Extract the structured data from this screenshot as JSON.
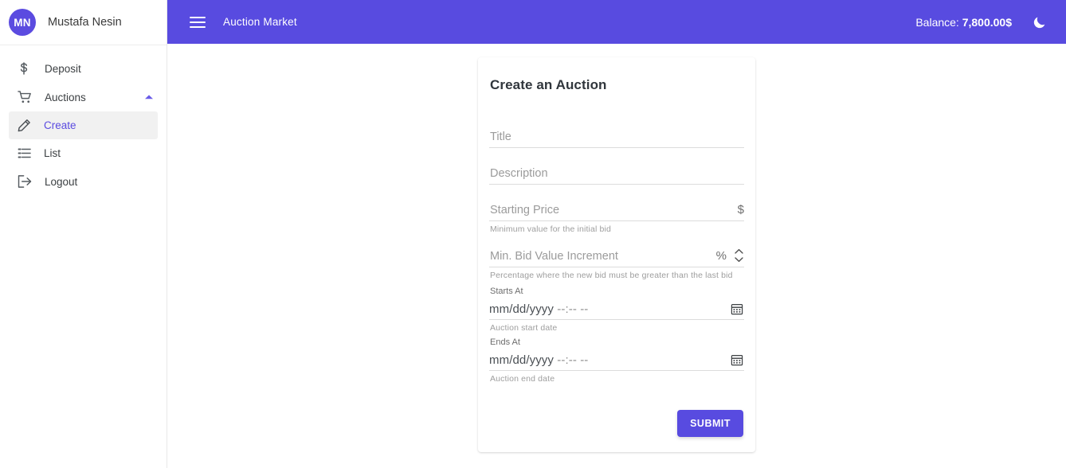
{
  "colors": {
    "accent": "#584be0",
    "accent_light": "#5b4be0",
    "sidebar_active_bg": "#f1f1f1",
    "page_bg": "#ffffff",
    "helper_text": "#9e9e9e"
  },
  "sidebar": {
    "profile": {
      "initials": "MN",
      "name": "Mustafa Nesin",
      "avatar_icon": "avatar-initials"
    },
    "items": [
      {
        "label": "Deposit",
        "icon": "dollar-icon",
        "level": "top",
        "active": false,
        "expandable": false
      },
      {
        "label": "Auctions",
        "icon": "shopping-cart-icon",
        "level": "top",
        "active": false,
        "expandable": true,
        "expand_icon": "chevron-up-icon"
      },
      {
        "label": "Create",
        "icon": "pencil-icon",
        "level": "sub",
        "active": true,
        "expandable": false
      },
      {
        "label": "List",
        "icon": "list-icon",
        "level": "sub",
        "active": false,
        "expandable": false
      },
      {
        "label": "Logout",
        "icon": "logout-icon",
        "level": "top",
        "active": false,
        "expandable": false
      }
    ]
  },
  "topbar": {
    "menu_icon": "hamburger-menu-icon",
    "title": "Auction Market",
    "balance_label": "Balance:",
    "balance_value": "7,800.00$",
    "theme_toggle_icon": "moon-icon"
  },
  "card": {
    "title": "Create an Auction",
    "fields": {
      "title": {
        "placeholder": "Title",
        "value": ""
      },
      "description": {
        "placeholder": "Description",
        "value": ""
      },
      "starting_price": {
        "placeholder": "Starting Price",
        "value": "",
        "adornment": "$",
        "helper": "Minimum value for the initial bid"
      },
      "min_bid_increment": {
        "placeholder": "Min. Bid Value Increment",
        "value": "",
        "adornment": "%",
        "spinner_icon": "number-spinner-icon",
        "helper": "Percentage where the new bid must be greater than the last bid"
      },
      "starts_at": {
        "label": "Starts At",
        "date_placeholder": "mm/dd/yyyy",
        "time_placeholder": "--:-- --",
        "calendar_icon": "calendar-icon",
        "helper": "Auction start date"
      },
      "ends_at": {
        "label": "Ends At",
        "date_placeholder": "mm/dd/yyyy",
        "time_placeholder": "--:-- --",
        "calendar_icon": "calendar-icon",
        "helper": "Auction end date"
      }
    },
    "submit_label": "SUBMIT"
  }
}
